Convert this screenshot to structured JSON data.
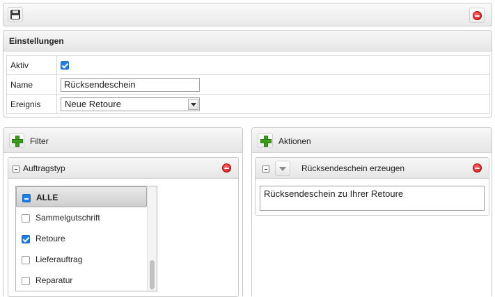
{
  "toolbar": {
    "save_icon": "floppy-disk-icon",
    "close_icon": "red-minus-circle-icon"
  },
  "settings": {
    "title": "Einstellungen",
    "active_label": "Aktiv",
    "active_checked": true,
    "name_label": "Name",
    "name_value": "Rücksendeschein",
    "event_label": "Ereignis",
    "event_value": "Neue Retoure"
  },
  "filter": {
    "title": "Filter",
    "add_icon": "green-plus-icon",
    "group": {
      "title": "Auftragstyp",
      "items": [
        {
          "label": "ALLE",
          "state": "indeterminate"
        },
        {
          "label": "Sammelgutschrift",
          "state": "unchecked"
        },
        {
          "label": "Retoure",
          "state": "checked"
        },
        {
          "label": "Lieferauftrag",
          "state": "unchecked"
        },
        {
          "label": "Reparatur",
          "state": "unchecked"
        }
      ]
    }
  },
  "actions": {
    "title": "Aktionen",
    "add_icon": "green-plus-icon",
    "item": {
      "title": "Rücksendeschein erzeugen",
      "text": "Rücksendeschein zu Ihrer Retoure"
    }
  },
  "colors": {
    "accent": "#1e7ee8",
    "add_green": "#3aa017",
    "remove_red": "#d40f0f"
  }
}
